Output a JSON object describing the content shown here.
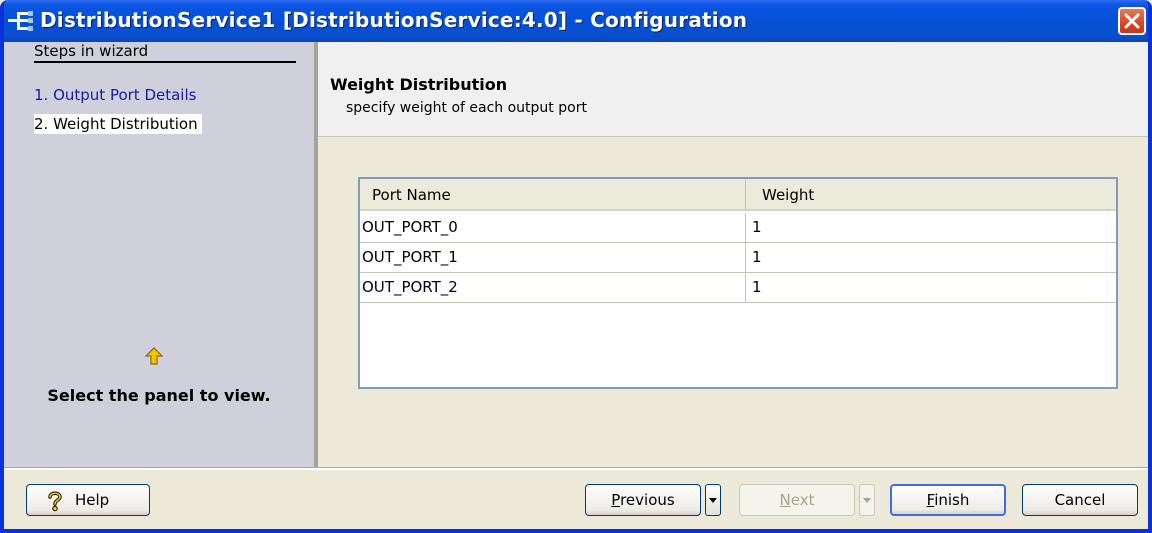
{
  "window": {
    "title": "DistributionService1 [DistributionService:4.0] - Configuration"
  },
  "sidebar": {
    "steps_title": "Steps in wizard",
    "steps": [
      {
        "label": "1. Output Port Details"
      },
      {
        "label": "2. Weight Distribution"
      }
    ],
    "hint": "Select the panel to view."
  },
  "panel": {
    "title": "Weight Distribution",
    "subtitle": "specify weight of each output port"
  },
  "table": {
    "columns": [
      "Port Name",
      "Weight"
    ],
    "rows": [
      {
        "port": "OUT_PORT_0",
        "weight": "1"
      },
      {
        "port": "OUT_PORT_1",
        "weight": "1"
      },
      {
        "port": "OUT_PORT_2",
        "weight": "1"
      }
    ]
  },
  "buttons": {
    "help": "Help",
    "previous_first": "P",
    "previous_rest": "revious",
    "next_first": "N",
    "next_rest": "ext",
    "finish_first": "F",
    "finish_rest": "inish",
    "cancel": "Cancel"
  },
  "colors": {
    "title_bar": "#0451d6",
    "sidebar_bg": "#cfd0dc",
    "step_link": "#1a1aa0",
    "close_button": "#d6452a"
  }
}
